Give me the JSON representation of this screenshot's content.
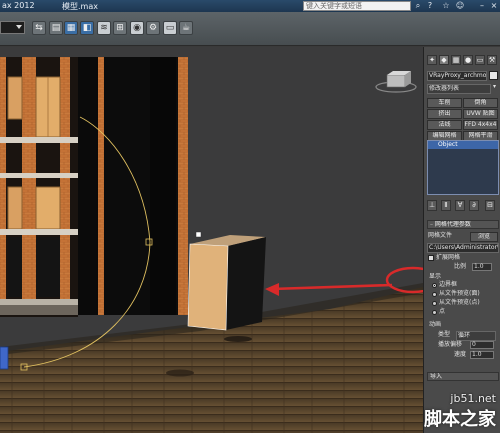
{
  "app": {
    "title": "ax 2012",
    "file_name": "模型.max",
    "search_placeholder": "键入关键字或短语",
    "colors": {
      "selection": "#3d66a8",
      "arrow": "#d82a2a",
      "title_bar": "#2a4a6a"
    }
  },
  "toolbar": {
    "icons": [
      "mirror-icon",
      "align-icon",
      "layer-icon",
      "graphite-icon",
      "curve-editor-icon",
      "schematic-icon",
      "material-editor-icon",
      "render-setup-icon",
      "rendered-frame-icon",
      "render-icon"
    ]
  },
  "panel": {
    "tabs": [
      "create-tab",
      "modify-tab",
      "hierarchy-tab",
      "motion-tab",
      "display-tab",
      "utilities-tab"
    ],
    "object_name": "VRayProxy_archmodels66_01",
    "modifier_list": "修改器列表",
    "modifier_buttons": [
      "车削",
      "倒角",
      "挤出",
      "UVW 贴图",
      "法线",
      "FFD 4x4x4",
      "编辑网格",
      "网格平滑"
    ],
    "stack_item": "Object",
    "rollout_title": "网格代理参数",
    "mesh_file_label": "网格文件",
    "browse_label": "浏览",
    "mesh_path": "C:\\Users\\Administrator\\Docume",
    "scale_label_check": "扩展网格",
    "scale_label": "比例",
    "scale_value": "1.0",
    "display_label": "显示",
    "display_options": [
      "边界框",
      "从文件预览(面)",
      "从文件预览(点)",
      "点"
    ],
    "animation_label": "动画",
    "type_label": "类型",
    "type_value": "循环",
    "offset_label": "播放偏移",
    "offset_value": "0",
    "speed_label": "速度",
    "speed_value": "1.0",
    "import_label": "导入"
  },
  "watermark": {
    "site": "jb51.net",
    "brand": "脚本之家"
  }
}
